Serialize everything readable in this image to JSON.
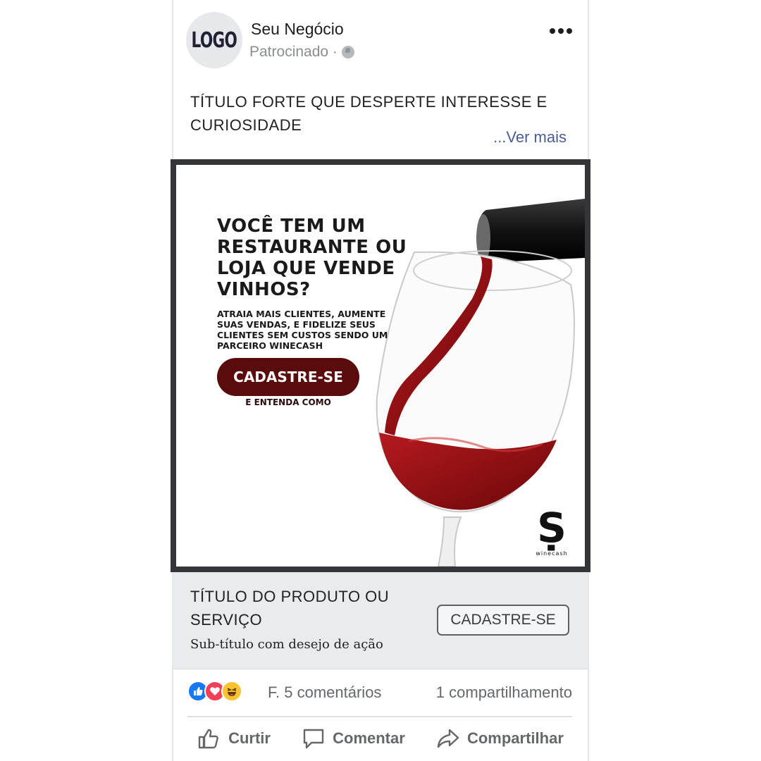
{
  "header": {
    "logo_text": "LOGO",
    "business_name": "Seu Negócio",
    "sponsored_label": "Patrocinado ·"
  },
  "post": {
    "text": "TÍTULO FORTE QUE DESPERTE INTERESSE E CURIOSIDADE",
    "see_more": "...Ver mais"
  },
  "creative": {
    "headline": "VOCÊ TEM UM RESTAURANTE OU LOJA QUE VENDE VINHOS?",
    "body": "ATRAIA MAIS CLIENTES, AUMENTE SUAS VENDAS, E FIDELIZE SEUS CLIENTES SEM CUSTOS SENDO UM PARCEIRO WINECASH",
    "cta": "CADASTRE-SE",
    "cta_note": "E ENTENDA COMO",
    "brand_symbol": "Ṣ",
    "brand_name": "winecash",
    "colors": {
      "cta_background": "#5a0b0b",
      "wine": "#8e0f12"
    }
  },
  "link_preview": {
    "title": "TÍTULO DO PRODUTO OU SERVIÇO",
    "subtitle": "Sub-título com desejo de ação",
    "button": "CADASTRE-SE"
  },
  "engagement": {
    "reaction_icons": [
      "like-icon",
      "love-icon",
      "haha-icon"
    ],
    "reaction_count": "F.",
    "comments": "5 comentários",
    "shares": "1 compartilhamento"
  },
  "actions": {
    "like": "Curtir",
    "comment": "Comentar",
    "share": "Compartilhar"
  }
}
